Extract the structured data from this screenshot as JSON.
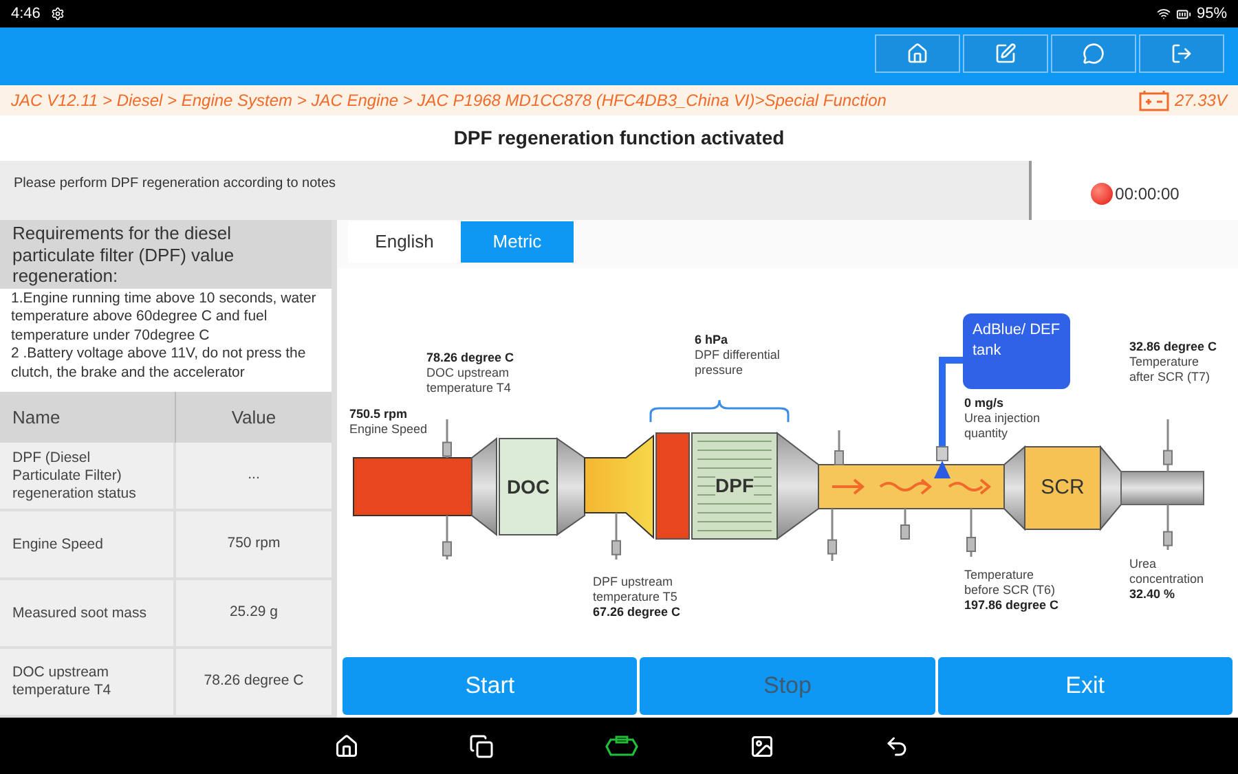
{
  "status_bar": {
    "time": "4:46",
    "battery": "95%"
  },
  "breadcrumb": {
    "path": "JAC V12.11 > Diesel > Engine System > JAC Engine > JAC P1968 MD1CC878 (HFC4DB3_China VI)>Special Function",
    "voltage": "27.33V"
  },
  "title": "DPF regeneration function activated",
  "notice": {
    "text": "Please perform DPF regeneration according to notes",
    "timer": "00:00:00"
  },
  "requirements": {
    "heading": "Requirements for the diesel particulate filter (DPF) value regeneration:",
    "lines": [
      "1.Engine running time above 10 seconds, water temperature above 60degree C and fuel temperature under 70degree C",
      "2 .Battery voltage above 11V, do not press the clutch, the brake and the accelerator"
    ]
  },
  "table": {
    "columns": [
      "Name",
      "Value"
    ],
    "rows": [
      {
        "name": "DPF (Diesel Particulate Filter) regeneration status",
        "value": "..."
      },
      {
        "name": "Engine Speed",
        "value": "750 rpm"
      },
      {
        "name": "Measured soot mass",
        "value": "25.29 g"
      },
      {
        "name": "DOC upstream temperature T4",
        "value": "78.26 degree C"
      }
    ]
  },
  "tabs": [
    {
      "label": "English",
      "selected": false
    },
    {
      "label": "Metric",
      "selected": true
    }
  ],
  "diagram": {
    "components": [
      "DOC",
      "DPF",
      "SCR"
    ],
    "tank": "AdBlue/ DEF tank",
    "labels": [
      {
        "kind": "value_top",
        "value": "750.5 rpm",
        "name": "Engine Speed"
      },
      {
        "kind": "value_top",
        "value": "78.26 degree C",
        "name": "DOC upstream temperature T4"
      },
      {
        "kind": "value_top",
        "value": "6 hPa",
        "name": "DPF differential pressure"
      },
      {
        "kind": "value_bottom",
        "name": "DPF upstream temperature T5",
        "value": "67.26 degree C"
      },
      {
        "kind": "value_top",
        "value": "0 mg/s",
        "name": "Urea injection quantity"
      },
      {
        "kind": "value_top",
        "value": "32.86 degree C",
        "name": "Temperature after SCR (T7)"
      },
      {
        "kind": "value_bottom",
        "name": "Temperature before SCR (T6)",
        "value": "197.86 degree C"
      },
      {
        "kind": "value_bottom",
        "name": "Urea concentration",
        "value": "32.40 %"
      }
    ]
  },
  "buttons": [
    {
      "label": "Start",
      "disabled": false
    },
    {
      "label": "Stop",
      "disabled": true
    },
    {
      "label": "Exit",
      "disabled": false
    }
  ]
}
